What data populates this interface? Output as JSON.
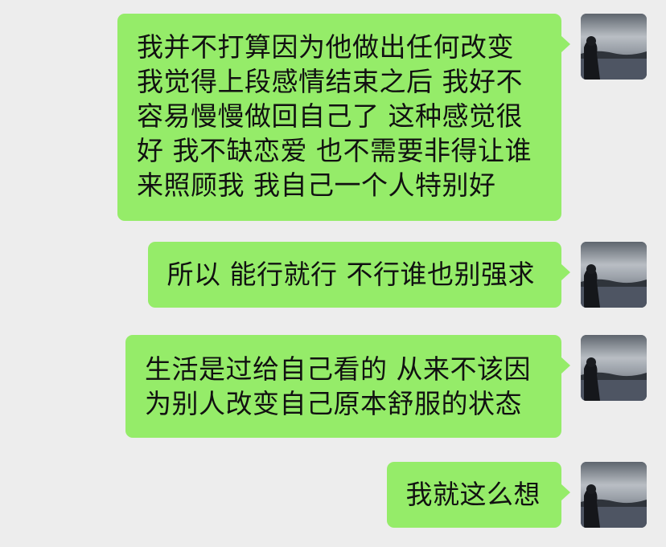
{
  "messages": [
    {
      "text": "我并不打算因为他做出任何改变 我觉得上段感情结束之后 我好不容易慢慢做回自己了 这种感觉很好 我不缺恋爱 也不需要非得让谁来照顾我 我自己一个人特别好"
    },
    {
      "text": "所以 能行就行 不行谁也别强求"
    },
    {
      "text": "生活是过给自己看的 从来不该因为别人改变自己原本舒服的状态"
    },
    {
      "text": "我就这么想"
    }
  ],
  "colors": {
    "background": "#ededed",
    "bubble": "#95ec69",
    "text": "#111111"
  },
  "avatar_icon": "avatar-photo-sunset-lake"
}
